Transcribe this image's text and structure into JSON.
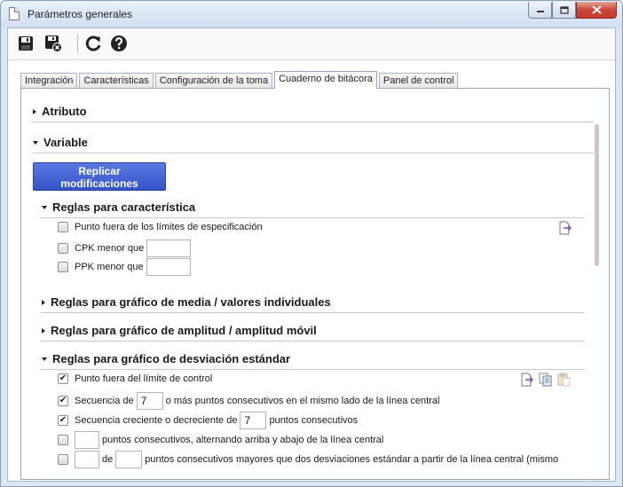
{
  "window": {
    "title": "Parámetros generales",
    "controls": {
      "minimize": "▭",
      "maximize": "□",
      "close": "✕"
    }
  },
  "toolbar": {
    "buttons": [
      {
        "name": "save-icon"
      },
      {
        "name": "save-and-close-icon"
      },
      {
        "name": "refresh-icon"
      },
      {
        "name": "help-icon"
      }
    ]
  },
  "tabs": [
    {
      "label": "Integración",
      "active": false
    },
    {
      "label": "Características",
      "active": false
    },
    {
      "label": "Configuración de la toma",
      "active": false
    },
    {
      "label": "Cuaderno de bitácora",
      "active": true
    },
    {
      "label": "Panel de control",
      "active": false
    }
  ],
  "sections": {
    "atributo": {
      "label": "Atributo",
      "expanded": false
    },
    "variable": {
      "label": "Variable",
      "expanded": true
    },
    "replicar_label_1": "Replicar",
    "replicar_label_2": "modificaciones",
    "reglas_caracteristica": {
      "label": "Reglas para característica",
      "expanded": true
    },
    "reglas_media": {
      "label": "Reglas para gráfico de media / valores individuales",
      "expanded": false
    },
    "reglas_amplitud": {
      "label": "Reglas para gráfico de amplitud / amplitud móvil",
      "expanded": false
    },
    "reglas_desviacion": {
      "label": "Reglas para gráfico de desviación estándar",
      "expanded": true
    }
  },
  "caracteristica_rules": {
    "punto_fuera": {
      "label": "Punto fuera de los límites de especificación",
      "checked": false
    },
    "cpk": {
      "label": "CPK menor que",
      "checked": false,
      "value": ""
    },
    "ppk": {
      "label": "PPK menor que",
      "checked": false,
      "value": ""
    }
  },
  "desviacion_rules": {
    "r1": {
      "label": "Punto fuera del límite de control",
      "checked": true
    },
    "r2": {
      "pre": "Secuencia de",
      "value": "7",
      "post": "o más puntos consecutivos en el mismo lado de la línea central",
      "checked": true
    },
    "r3": {
      "pre": "Secuencia creciente o decreciente de",
      "value": "7",
      "post": "puntos consecutivos",
      "checked": true
    },
    "r4": {
      "value": "",
      "post": "puntos consecutivos, alternando arriba y abajo de la línea central",
      "checked": false
    },
    "r5": {
      "value1": "",
      "mid": "de",
      "value2": "",
      "post": "puntos consecutivos mayores que dos desviaciones estándar a partir de la línea central (mismo",
      "checked": false
    }
  }
}
